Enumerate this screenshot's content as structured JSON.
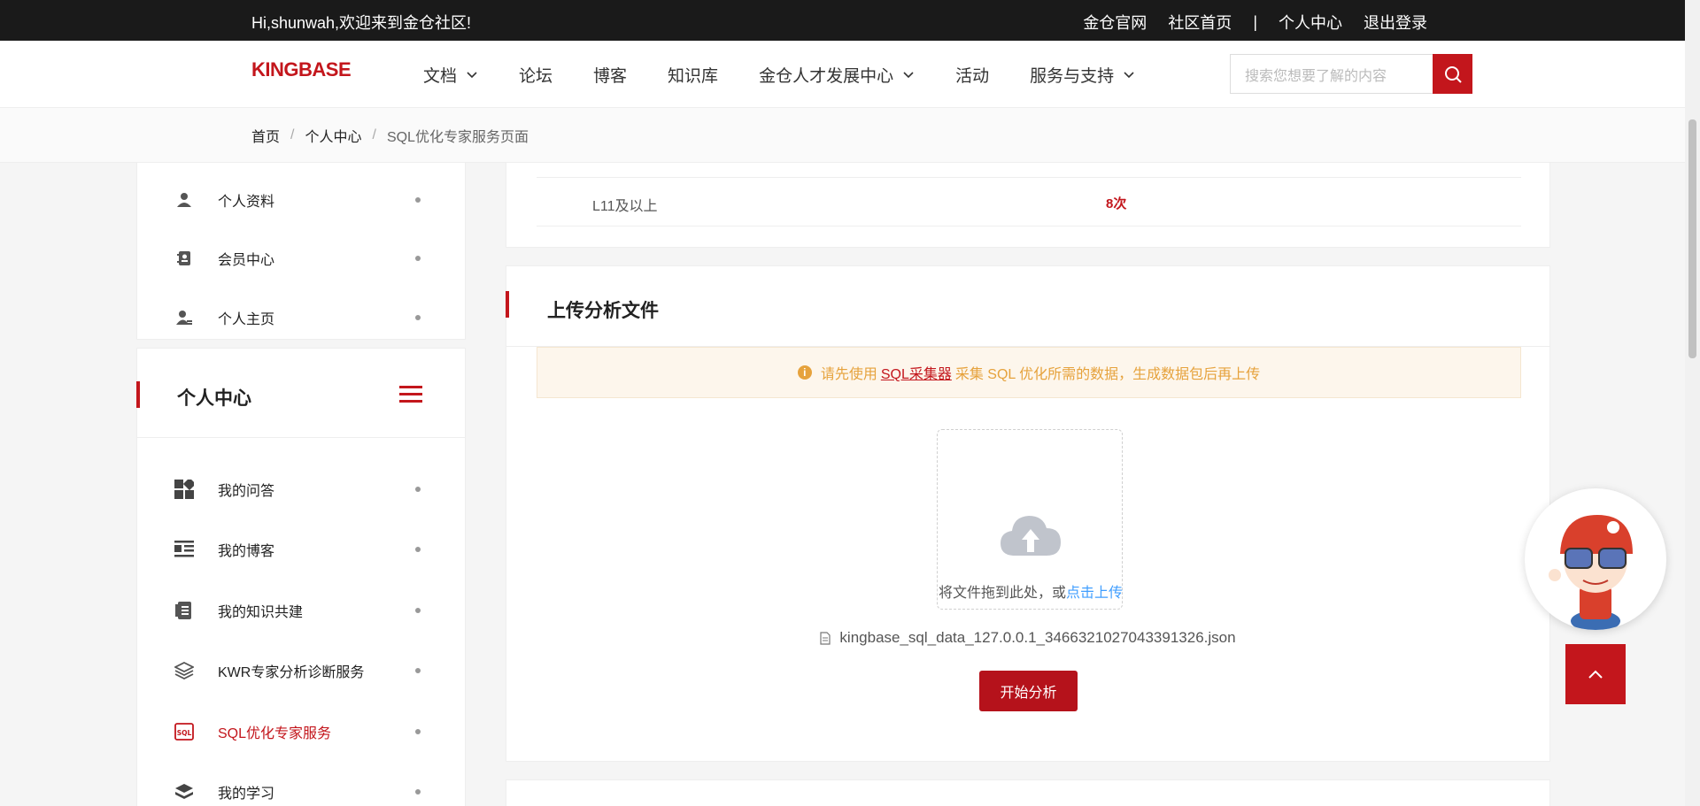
{
  "topbar": {
    "welcome": "Hi,shunwah,欢迎来到金仓社区!",
    "links": [
      "金仓官网",
      "社区首页",
      "个人中心",
      "退出登录"
    ],
    "separator": "|"
  },
  "brand": {
    "logo_text": "KINGBASE",
    "accent": "#c3161c"
  },
  "nav": {
    "items": [
      {
        "label": "文档",
        "dropdown": true
      },
      {
        "label": "论坛",
        "dropdown": false
      },
      {
        "label": "博客",
        "dropdown": false
      },
      {
        "label": "知识库",
        "dropdown": false
      },
      {
        "label": "金仓人才发展中心",
        "dropdown": true
      },
      {
        "label": "活动",
        "dropdown": false
      },
      {
        "label": "服务与支持",
        "dropdown": true
      }
    ],
    "search_placeholder": "搜索您想要了解的内容"
  },
  "breadcrumb": {
    "home": "首页",
    "center": "个人中心",
    "current": "SQL优化专家服务页面",
    "separator": "/"
  },
  "sidebar": {
    "top_items": [
      {
        "label": "个人资料",
        "icon": "user-icon"
      },
      {
        "label": "会员中心",
        "icon": "member-card-icon"
      },
      {
        "label": "个人主页",
        "icon": "user-home-icon"
      }
    ],
    "section_title": "个人中心",
    "items": [
      {
        "label": "我的问答",
        "icon": "qa-grid-icon"
      },
      {
        "label": "我的博客",
        "icon": "blog-list-icon"
      },
      {
        "label": "我的知识共建",
        "icon": "knowledge-book-icon"
      },
      {
        "label": "KWR专家分析诊断服务",
        "icon": "layers-icon"
      },
      {
        "label": "SQL优化专家服务",
        "icon": "sql-icon",
        "active": true
      },
      {
        "label": "我的学习",
        "icon": "stack-icon"
      }
    ]
  },
  "level_row": {
    "level": "L11及以上",
    "count": "8次"
  },
  "upload": {
    "title": "上传分析文件",
    "alert_prefix": "请先使用",
    "alert_link": "SQL采集器",
    "alert_suffix": "采集 SQL 优化所需的数据，生成数据包后再上传",
    "drop_hint": "将文件拖到此处，或",
    "drop_link": "点击上传",
    "file_name": "kingbase_sql_data_127.0.0.1_3466321027043391326.json",
    "analyze_button": "开始分析"
  }
}
